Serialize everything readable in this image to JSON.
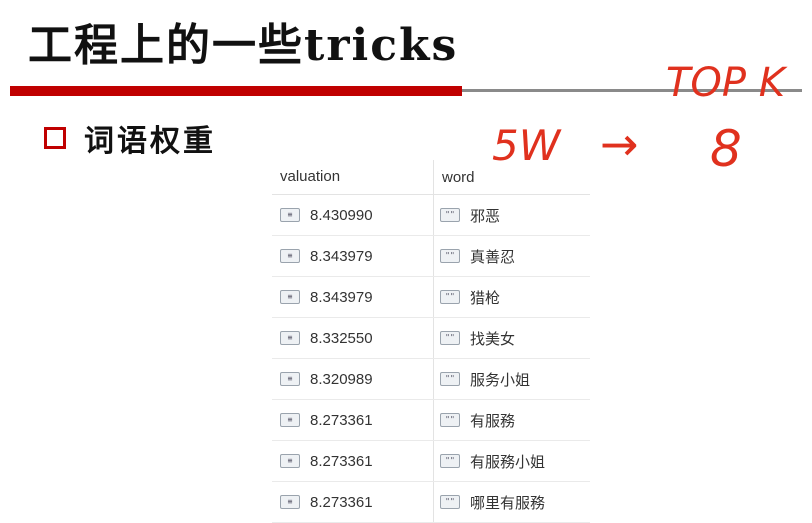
{
  "slide": {
    "title": "工程上的一些tricks",
    "bullet": "词语权重"
  },
  "annotation": {
    "top": "TOP K",
    "left": "5W",
    "arrow": "→",
    "right": "8"
  },
  "table": {
    "headers": [
      "valuation",
      "word"
    ],
    "rows": [
      {
        "valuation": "8.430990",
        "word": "邪恶"
      },
      {
        "valuation": "8.343979",
        "word": "真善忍"
      },
      {
        "valuation": "8.343979",
        "word": "猎枪"
      },
      {
        "valuation": "8.332550",
        "word": "找美女"
      },
      {
        "valuation": "8.320989",
        "word": "服务小姐"
      },
      {
        "valuation": "8.273361",
        "word": "有服務"
      },
      {
        "valuation": "8.273361",
        "word": "有服務小姐"
      },
      {
        "valuation": "8.273361",
        "word": "哪里有服務"
      }
    ]
  },
  "icons": {
    "number_type": "number-type-icon",
    "string_type": "string-type-icon"
  },
  "colors": {
    "accent_red": "#c00000",
    "annotation_red": "#e0311e"
  }
}
